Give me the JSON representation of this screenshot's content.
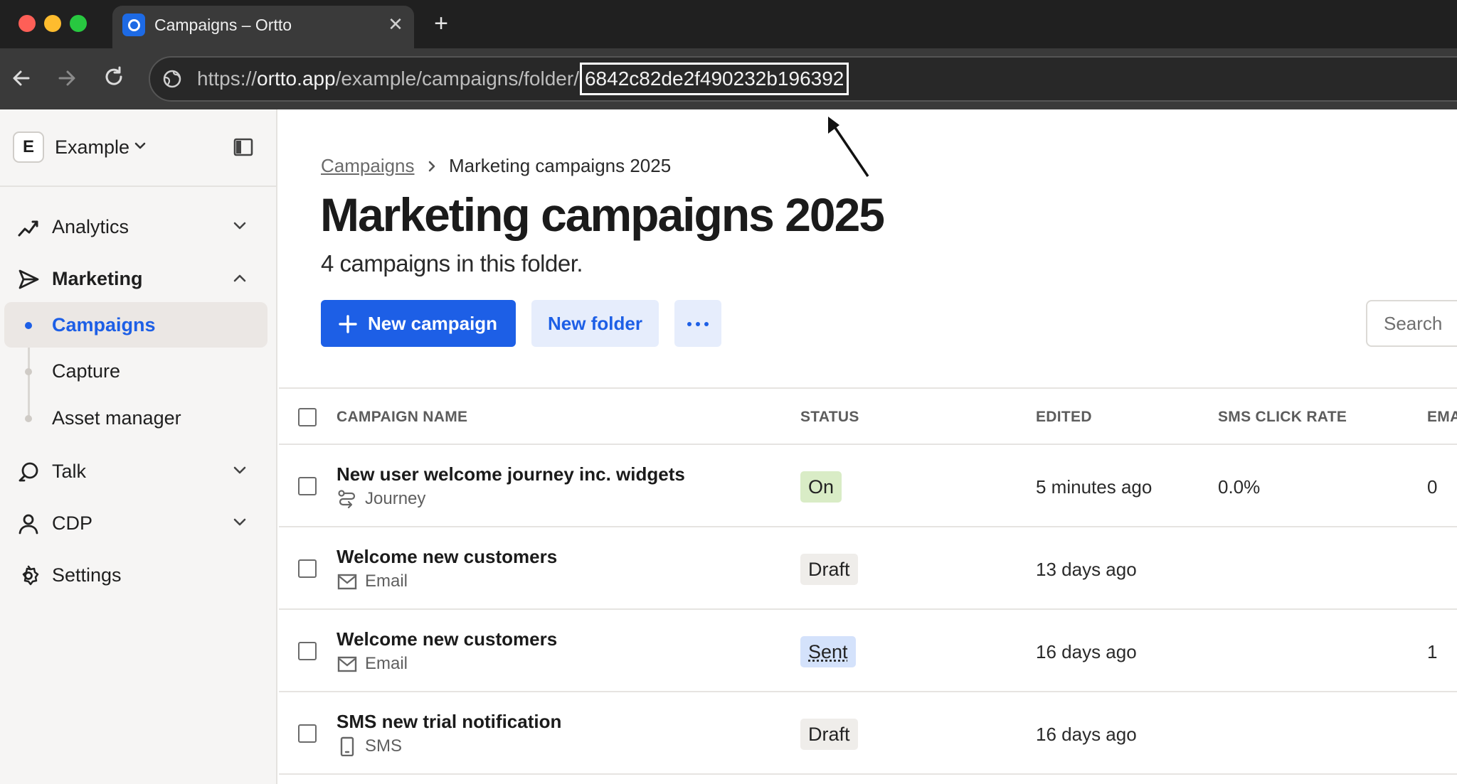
{
  "browser": {
    "tab_title": "Campaigns – Ortto",
    "url_scheme": "https://",
    "url_host": "ortto.app",
    "url_path": "/example/campaigns/folder/",
    "url_id": "6842c82de2f490232b196392"
  },
  "sidebar": {
    "workspace_initial": "E",
    "workspace_name": "Example",
    "sections": [
      {
        "label": "Analytics",
        "icon": "analytics-icon",
        "expanded": false
      },
      {
        "label": "Marketing",
        "icon": "send-icon",
        "expanded": true
      },
      {
        "label": "Talk",
        "icon": "chat-icon",
        "expanded": false
      },
      {
        "label": "CDP",
        "icon": "person-icon",
        "expanded": false
      },
      {
        "label": "Settings",
        "icon": "gear-icon"
      }
    ],
    "marketing_items": [
      {
        "label": "Campaigns",
        "active": true
      },
      {
        "label": "Capture",
        "active": false
      },
      {
        "label": "Asset manager",
        "active": false
      }
    ]
  },
  "breadcrumb": {
    "parent": "Campaigns",
    "current": "Marketing campaigns 2025"
  },
  "page": {
    "title": "Marketing campaigns 2025",
    "subtitle": "4 campaigns in this folder."
  },
  "actions": {
    "new_campaign": "New campaign",
    "new_folder": "New folder",
    "search_placeholder": "Search"
  },
  "table": {
    "headers": {
      "name": "CAMPAIGN NAME",
      "status": "STATUS",
      "edited": "EDITED",
      "sms_click_rate": "SMS CLICK RATE",
      "email": "EMA"
    },
    "rows": [
      {
        "name": "New user welcome journey inc. widgets",
        "type": "Journey",
        "icon": "journey-icon",
        "status": "On",
        "edited": "5 minutes ago",
        "sms_click_rate": "0.0%",
        "email": "0"
      },
      {
        "name": "Welcome new customers",
        "type": "Email",
        "icon": "mail-icon",
        "status": "Draft",
        "edited": "13 days ago",
        "sms_click_rate": "",
        "email": ""
      },
      {
        "name": "Welcome new customers",
        "type": "Email",
        "icon": "mail-icon",
        "status": "Sent",
        "edited": "16 days ago",
        "sms_click_rate": "",
        "email": "1"
      },
      {
        "name": "SMS new trial notification",
        "type": "SMS",
        "icon": "phone-icon",
        "status": "Draft",
        "edited": "16 days ago",
        "sms_click_rate": "",
        "email": ""
      }
    ]
  },
  "colors": {
    "accent": "#1d5fe6",
    "status_on": "#d9ecc6",
    "status_draft": "#efedea",
    "status_sent": "#d4e2fb"
  }
}
